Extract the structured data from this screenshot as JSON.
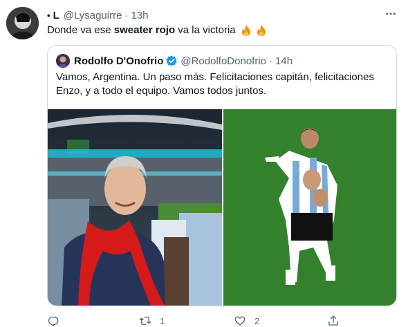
{
  "tweet": {
    "user_marker": "•",
    "name": "L",
    "handle": "@Lysaguirre",
    "separator": "·",
    "time": "13h",
    "text_before": "Donde va ese ",
    "text_bold": "sweater rojo",
    "text_after": " va la victoria"
  },
  "quote": {
    "name": "Rodolfo D'Onofrio",
    "handle": "@RodolfoDonofrio",
    "separator": "·",
    "time": "14h",
    "text": "Vamos, Argentina. Un paso más. Felicitaciones capitán, felicitaciones Enzo, y a todo el equipo. Vamos todos juntos."
  },
  "actions": {
    "reply_count": "",
    "retweet_count": "1",
    "like_count": "2"
  },
  "colors": {
    "secondary_text": "#536471",
    "border": "#cfd9de",
    "verified": "#1d9bf0",
    "pitch_green": "#2f7a2a"
  },
  "icons": [
    "more-icon",
    "fire-icon",
    "verified-icon",
    "reply-icon",
    "retweet-icon",
    "like-icon",
    "share-icon"
  ]
}
